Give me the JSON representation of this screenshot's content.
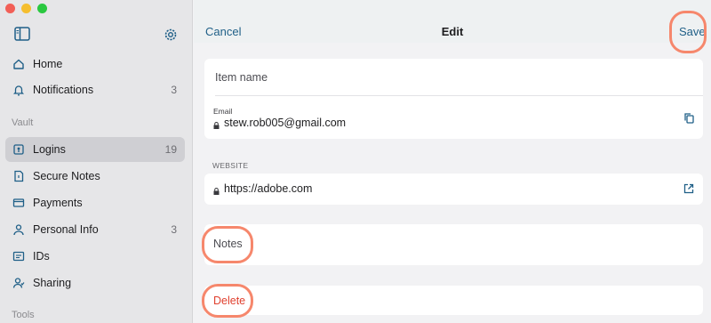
{
  "sidebar": {
    "items_top": [
      {
        "label": "Home",
        "icon": "home-icon"
      },
      {
        "label": "Notifications",
        "icon": "bell-icon",
        "count": "3"
      }
    ],
    "vault_label": "Vault",
    "vault_items": [
      {
        "label": "Logins",
        "icon": "key-icon",
        "count": "19",
        "active": true
      },
      {
        "label": "Secure Notes",
        "icon": "note-icon"
      },
      {
        "label": "Payments",
        "icon": "card-icon"
      },
      {
        "label": "Personal Info",
        "icon": "person-icon",
        "count": "3"
      },
      {
        "label": "IDs",
        "icon": "id-icon"
      },
      {
        "label": "Sharing",
        "icon": "sharing-icon"
      }
    ],
    "tools_label": "Tools"
  },
  "toolbar": {
    "cancel_label": "Cancel",
    "title": "Edit",
    "save_label": "Save"
  },
  "form": {
    "item_name_placeholder": "Item name",
    "email_label": "Email",
    "email_value": "stew.rob005@gmail.com",
    "website_caption": "WEBSITE",
    "website_value": "https://adobe.com",
    "notes_placeholder": "Notes",
    "delete_label": "Delete"
  },
  "colors": {
    "accent": "#1f5f87",
    "danger": "#e0402f",
    "highlight": "#f6876c",
    "sidebar_bg": "#e6e6e8"
  }
}
